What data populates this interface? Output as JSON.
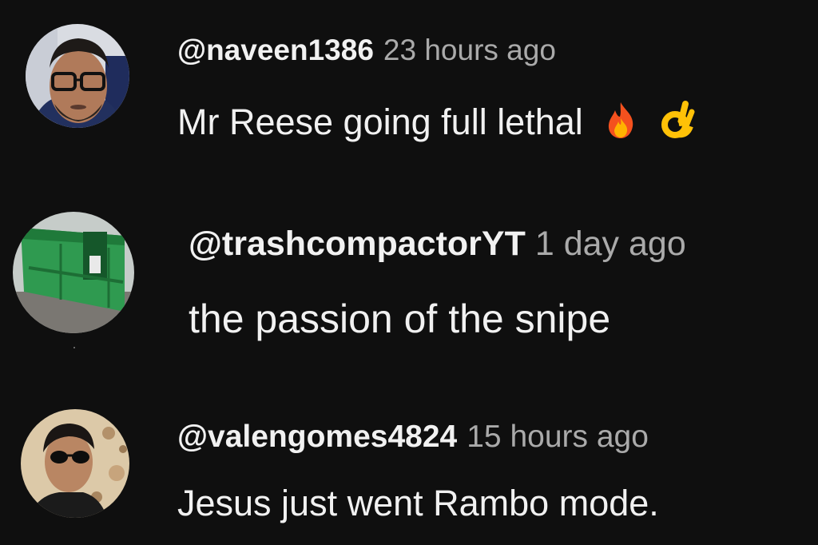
{
  "comments": [
    {
      "handle": "@naveen1386",
      "time": "23 hours ago",
      "text": "Mr Reese going full lethal",
      "emojis": [
        "fire-icon",
        "ok-hand-icon"
      ],
      "avatar": "man-with-glasses-avatar"
    },
    {
      "handle": "@trashcompactorYT",
      "time": "1 day ago",
      "text": "the passion of the snipe",
      "emojis": [],
      "avatar": "green-dumpster-avatar"
    },
    {
      "handle": "@valengomes4824",
      "time": "15 hours ago",
      "text": "Jesus just went Rambo mode.",
      "emojis": [],
      "avatar": "man-with-sunglasses-avatar"
    }
  ],
  "colors": {
    "background": "#0f0f0f",
    "primary_text": "#f1f1f1",
    "secondary_text": "#aaaaaa"
  }
}
